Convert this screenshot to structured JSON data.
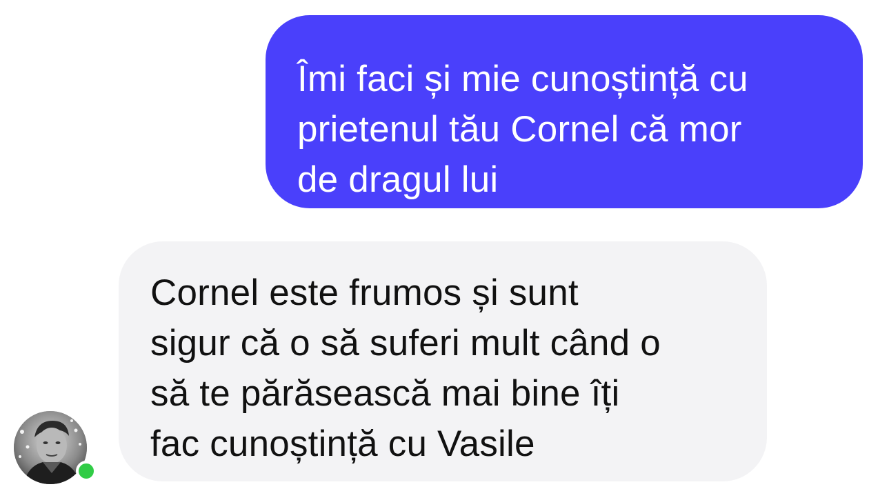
{
  "conversation": {
    "messages": [
      {
        "direction": "outgoing",
        "lines": [
          "Îmi faci și mie cunoștință cu",
          "prietenul tău Cornel că mor",
          "de dragul lui"
        ]
      },
      {
        "direction": "incoming",
        "lines": [
          "Cornel este frumos și sunt",
          "sigur că o să suferi mult când o",
          "să te părăsească mai bine îți",
          "fac cunoștință cu Vasile"
        ]
      }
    ]
  },
  "contact": {
    "avatar_icon": "profile-photo",
    "online": true
  },
  "colors": {
    "outgoing_bubble": "#4a40fb",
    "incoming_bubble": "#f3f3f5",
    "presence": "#31cc46"
  }
}
